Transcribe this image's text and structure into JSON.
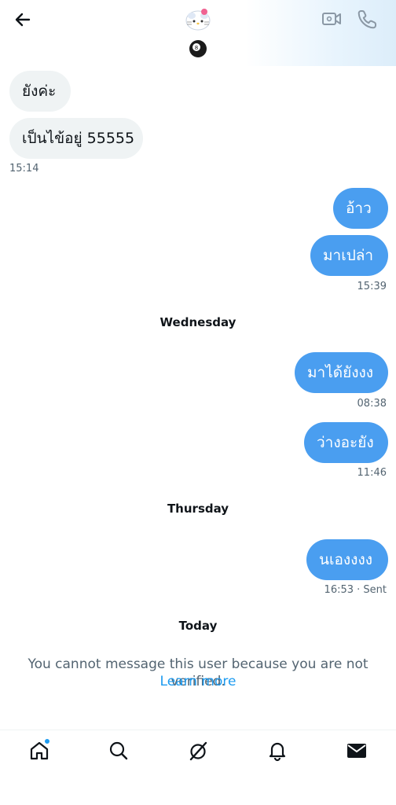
{
  "header": {
    "back_icon": "arrow-left-icon",
    "avatar_icon": "hello-kitty-avatar",
    "status_emoji": "🎱",
    "video_icon": "video-camera-icon",
    "call_icon": "phone-icon"
  },
  "messages": [
    {
      "dir": "in",
      "text": "ยังค่ะ"
    },
    {
      "dir": "in",
      "text": "เป็นไข้อยู่ 55555"
    },
    {
      "time": "15:14"
    },
    {
      "dir": "out",
      "text": "อ้าว"
    },
    {
      "dir": "out",
      "text": "มาเปล่า"
    },
    {
      "time": "15:39"
    },
    {
      "day": "Wednesday"
    },
    {
      "dir": "out",
      "text": "มาได้ยังงง"
    },
    {
      "time": "08:38"
    },
    {
      "dir": "out",
      "text": "ว่างอะยัง"
    },
    {
      "time": "11:46"
    },
    {
      "day": "Thursday"
    },
    {
      "dir": "out",
      "text": "นเองงงง"
    },
    {
      "time": "16:53 · Sent"
    },
    {
      "day": "Today"
    }
  ],
  "notice": {
    "text": "You cannot message this user because you are not verified.",
    "link": "Learn more"
  },
  "tabbar": {
    "items": [
      "home-icon",
      "search-icon",
      "grok-icon",
      "notifications-bell-icon",
      "messages-envelope-icon"
    ],
    "home_has_notification": true
  },
  "colors": {
    "accent": "#1d9bf0",
    "outgoing_bubble": "#4a9ef0",
    "incoming_bubble": "#eff3f4",
    "muted_text": "#536471"
  }
}
